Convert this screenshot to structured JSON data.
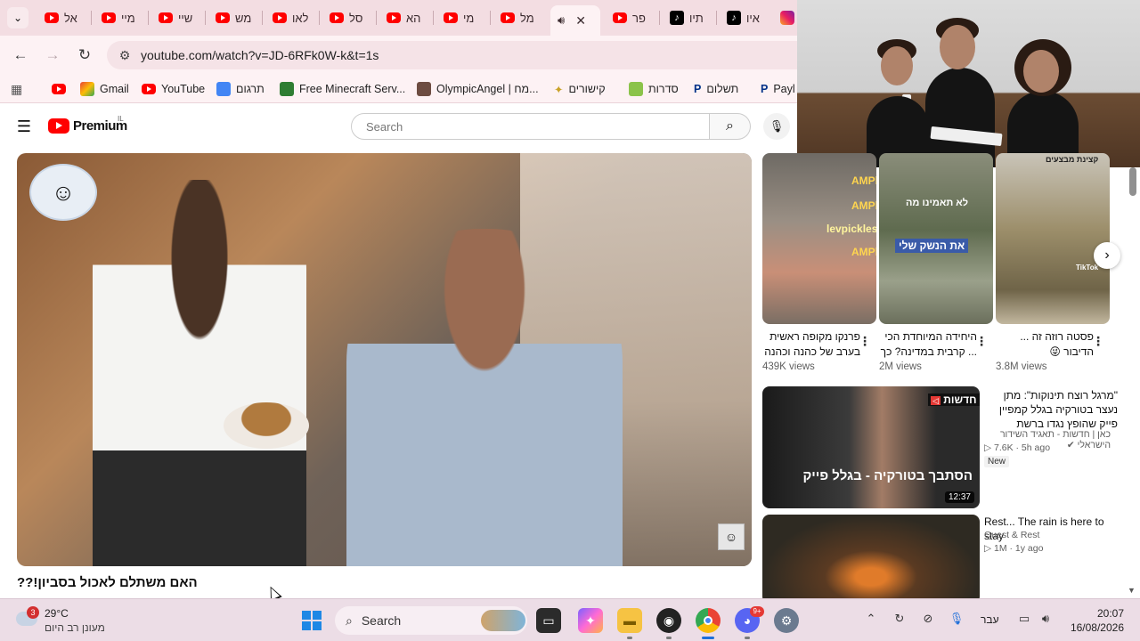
{
  "browser": {
    "tabs": [
      {
        "label": "אל",
        "icon": "youtube-icon"
      },
      {
        "label": "מיי",
        "icon": "youtube-icon"
      },
      {
        "label": "שיי",
        "icon": "youtube-icon"
      },
      {
        "label": "מש",
        "icon": "youtube-icon"
      },
      {
        "label": "לאו",
        "icon": "youtube-icon"
      },
      {
        "label": "סל",
        "icon": "youtube-icon"
      },
      {
        "label": "הא",
        "icon": "youtube-icon"
      },
      {
        "label": "מי",
        "icon": "youtube-icon"
      },
      {
        "label": "מל",
        "icon": "youtube-icon"
      },
      {
        "label": "",
        "icon": "speaker-icon",
        "active": true
      },
      {
        "label": "פר",
        "icon": "youtube-icon"
      },
      {
        "label": "תיו",
        "icon": "tiktok-icon"
      },
      {
        "label": "איו",
        "icon": "tiktok-icon"
      },
      {
        "label": "",
        "icon": "instagram-icon"
      }
    ],
    "url": "youtube.com/watch?v=JD-6RFk0W-k&t=1s",
    "bookmarks": [
      {
        "label": "",
        "icon": "youtube-icon"
      },
      {
        "label": "Gmail",
        "icon": "gmail-icon"
      },
      {
        "label": "YouTube",
        "icon": "youtube-icon"
      },
      {
        "label": "תרגום",
        "icon": "translate-icon"
      },
      {
        "label": "Free Minecraft Serv...",
        "icon": "minecraft-icon"
      },
      {
        "label": "OlympicAngel | מח...",
        "icon": "avatar-icon"
      },
      {
        "label": "קישורים",
        "icon": "star-icon"
      },
      {
        "label": "סדרות",
        "icon": "folder-icon"
      },
      {
        "label": "תשלום",
        "icon": "paypal-icon"
      },
      {
        "label": "Payl",
        "icon": "paypal-icon"
      }
    ]
  },
  "youtube": {
    "logo_text": "Premium",
    "country_code": "IL",
    "search_placeholder": "Search",
    "video_title": "האם משתלם לאכול בסביון!??",
    "shorts": [
      {
        "title": "פרנקו מקופה ראשית בערב של כהנה וכהנה",
        "views": "439K views",
        "overlay": [
          "AMPlaying",
          "AMPlaying",
          "levpickles",
          "AMPlaying"
        ]
      },
      {
        "title": "היחידה המיוחדת הכי ... קרבית במדינה? כך",
        "views": "2M views",
        "overlay": [
          "לא תאמינו מה",
          "את הנשק שלי"
        ]
      },
      {
        "title": "פסטה רוזה זה ... הדיבור 😜",
        "views": "3.8M views",
        "overlay": [
          "קצינת מבצעים",
          "TikTok"
        ]
      }
    ],
    "recommended": [
      {
        "title": "\"מרגל רוצח תינוקות\": מתן נעצר בטורקיה בגלל קמפיין פייק שהופץ נגדו ברשת",
        "channel": "כאן | חדשות - תאגיד השידור הישראלי",
        "meta": "7.6K · 5h ago",
        "badge": "New",
        "duration": "12:37",
        "thumb_overlay": "הסתבך בטורקיה - בגלל פייק",
        "thumb_tag": "חדשות"
      },
      {
        "title": "Rest... The rain is here to stay",
        "channel": "Quest & Rest",
        "meta": "1M · 1y ago"
      }
    ]
  },
  "taskbar": {
    "weather_temp": "29°C",
    "weather_desc": "מעונן רב היום",
    "weather_badge": "3",
    "search_label": "Search",
    "discord_badge": "9+",
    "language": "עבר",
    "time": "20:07",
    "date": "16/08/2026"
  },
  "colors": {
    "accent": "#ff0000",
    "tabstrip": "#f3dde2",
    "taskbar": "#ecdde6"
  }
}
